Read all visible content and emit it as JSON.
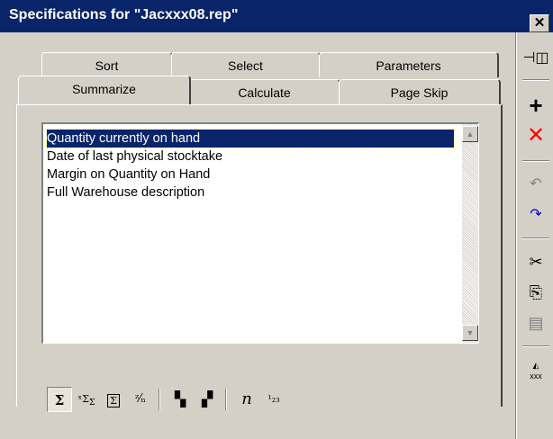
{
  "window": {
    "title": "Specifications for \"Jacxxx08.rep\"",
    "close_label": "✕"
  },
  "tabs_back": [
    {
      "label": "Sort"
    },
    {
      "label": "Select"
    },
    {
      "label": "Parameters"
    }
  ],
  "tabs_front": [
    {
      "label": "Summarize",
      "active": true
    },
    {
      "label": "Calculate"
    },
    {
      "label": "Page Skip"
    }
  ],
  "list": {
    "items": [
      {
        "label": "Quantity currently on hand",
        "selected": true
      },
      {
        "label": "Date of last physical stocktake"
      },
      {
        "label": "Margin on Quantity on Hand"
      },
      {
        "label": "Full Warehouse description"
      }
    ]
  },
  "bottom_toolbar": [
    {
      "icon": "sigma-icon",
      "glyph": "Σ",
      "pressed": true
    },
    {
      "icon": "sub-sigma-icon",
      "glyph": "ˣΣΣ"
    },
    {
      "icon": "sigma-page-icon",
      "glyph": "Σ"
    },
    {
      "icon": "sigma-divide-icon",
      "glyph": "Σ⁄n"
    },
    {
      "icon": "group-up-icon",
      "glyph": "▚"
    },
    {
      "icon": "group-down-icon",
      "glyph": "▞"
    },
    {
      "icon": "count-n-icon",
      "glyph": "n"
    },
    {
      "icon": "rank-icon",
      "glyph": "¹₂₃"
    }
  ],
  "side_toolbar": [
    {
      "icon": "pin-icon",
      "glyph": "⊣"
    },
    {
      "icon": "add-icon",
      "glyph": "+"
    },
    {
      "icon": "delete-icon",
      "glyph": "✕"
    },
    {
      "icon": "undo-icon",
      "glyph": "↶"
    },
    {
      "icon": "redo-icon",
      "glyph": "↷"
    },
    {
      "icon": "cut-icon",
      "glyph": "✂"
    },
    {
      "icon": "copy-icon",
      "glyph": "⎘"
    },
    {
      "icon": "paste-icon",
      "glyph": "📋"
    },
    {
      "icon": "rename-icon",
      "glyph": "xxx"
    }
  ],
  "colors": {
    "titlebar": "#0a246a",
    "face": "#d4d0c8",
    "selection": "#0a246a",
    "delete_red": "#ff0000",
    "redo_blue": "#0000cc"
  }
}
